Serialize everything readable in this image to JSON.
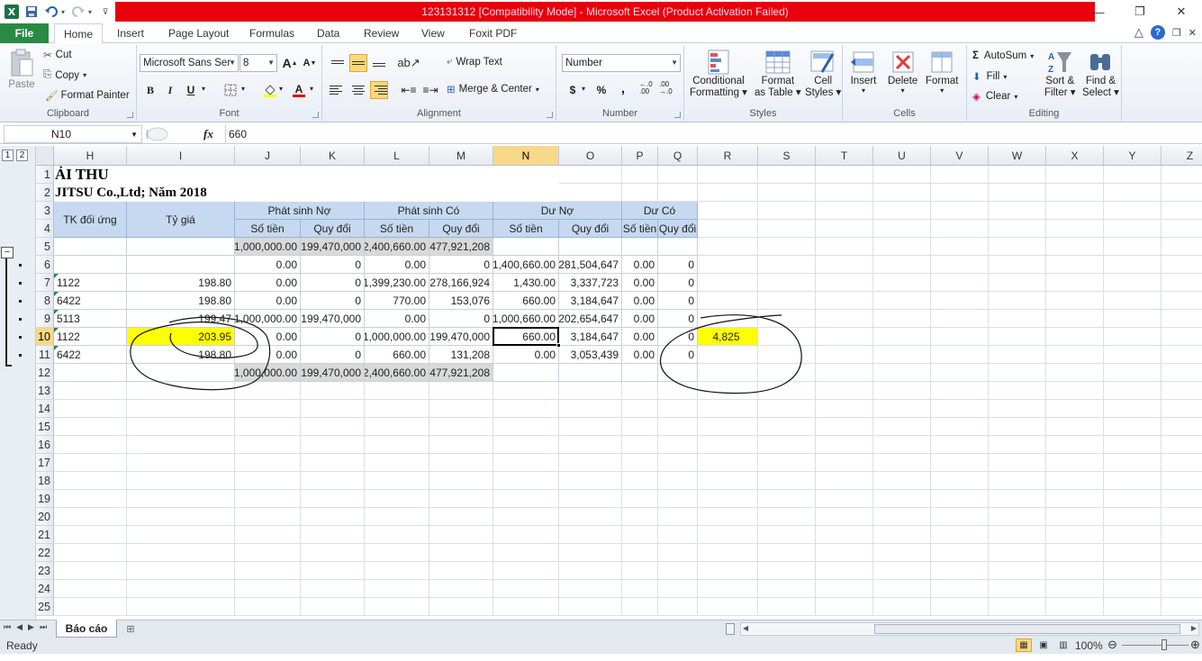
{
  "window": {
    "title": "123131312  [Compatibility Mode]  -  Microsoft Excel (Product Activation Failed)",
    "title_bar_color": "#e8000c",
    "controls": {
      "minimize": "—",
      "restore": "❐",
      "close": "✕"
    }
  },
  "ribbon_tabs": {
    "file": "File",
    "tabs": [
      "Home",
      "Insert",
      "Page Layout",
      "Formulas",
      "Data",
      "Review",
      "View",
      "Foxit PDF"
    ],
    "active": "Home"
  },
  "ribbon": {
    "clipboard": {
      "paste": "Paste",
      "cut": "Cut",
      "copy": "Copy",
      "format_painter": "Format Painter",
      "label": "Clipboard"
    },
    "font": {
      "name": "Microsoft Sans Ser",
      "size": "8",
      "bold": "B",
      "italic": "I",
      "underline": "U",
      "label": "Font"
    },
    "alignment": {
      "wrap_text": "Wrap Text",
      "merge_center": "Merge & Center",
      "label": "Alignment"
    },
    "number": {
      "format": "Number",
      "currency": "$",
      "percent": "%",
      "comma": ",",
      "inc_decimal": "←.0\n.00",
      "dec_decimal": ".00\n→.0",
      "label": "Number"
    },
    "styles": {
      "conditional": [
        "Conditional",
        "Formatting"
      ],
      "format_table": [
        "Format",
        "as Table"
      ],
      "cell_styles": [
        "Cell",
        "Styles"
      ],
      "label": "Styles"
    },
    "cells": {
      "insert": "Insert",
      "delete": "Delete",
      "format": "Format",
      "label": "Cells"
    },
    "editing": {
      "autosum": "AutoSum",
      "fill": "Fill",
      "clear": "Clear",
      "sort": [
        "Sort &",
        "Filter"
      ],
      "find": [
        "Find &",
        "Select"
      ],
      "label": "Editing"
    }
  },
  "formula_bar": {
    "name_box": "N10",
    "fx": "fx",
    "value": "660"
  },
  "outline": {
    "levels": [
      "1",
      "2"
    ],
    "collapse": "−"
  },
  "columns": [
    "H",
    "I",
    "J",
    "K",
    "L",
    "M",
    "N",
    "O",
    "P",
    "Q",
    "R",
    "S",
    "T",
    "U",
    "V",
    "W",
    "X",
    "Y",
    "Z"
  ],
  "rows": [
    "1",
    "2",
    "3",
    "4",
    "5",
    "6",
    "7",
    "8",
    "9",
    "10",
    "11",
    "12",
    "13",
    "14",
    "15",
    "16",
    "17",
    "18",
    "19",
    "20",
    "21",
    "22",
    "23",
    "24",
    "25"
  ],
  "sheet": {
    "title": "ẢI THU",
    "subtitle": "JITSU Co.,Ltd; Năm 2018",
    "headers": {
      "tk_doi_ung": "TK đối ứng",
      "ty_gia": "Tỷ giá",
      "phat_sinh_no": "Phát sinh Nợ",
      "phat_sinh_co": "Phát sinh Có",
      "du_no": "Dư Nợ",
      "du_co": "Dư Có",
      "so_tien": "Số tiền",
      "quy_doi": "Quy đổi"
    },
    "data_rows": [
      {
        "row": "5",
        "H": "",
        "I": "",
        "J": "1,000,000.00",
        "K": "199,470,000",
        "L": "2,400,660.00",
        "M": "477,921,208",
        "N": "",
        "O": "",
        "P": "",
        "Q": ""
      },
      {
        "row": "6",
        "H": "",
        "I": "",
        "J": "0.00",
        "K": "0",
        "L": "0.00",
        "M": "0",
        "N": "1,400,660.00",
        "O": "281,504,647",
        "P": "0.00",
        "Q": "0"
      },
      {
        "row": "7",
        "H": "1122",
        "I": "198.80",
        "J": "0.00",
        "K": "0",
        "L": "1,399,230.00",
        "M": "278,166,924",
        "N": "1,430.00",
        "O": "3,337,723",
        "P": "0.00",
        "Q": "0"
      },
      {
        "row": "8",
        "H": "6422",
        "I": "198.80",
        "J": "0.00",
        "K": "0",
        "L": "770.00",
        "M": "153,076",
        "N": "660.00",
        "O": "3,184,647",
        "P": "0.00",
        "Q": "0"
      },
      {
        "row": "9",
        "H": "5113",
        "I": "199.47",
        "J": "1,000,000.00",
        "K": "199,470,000",
        "L": "0.00",
        "M": "0",
        "N": "1,000,660.00",
        "O": "202,654,647",
        "P": "0.00",
        "Q": "0"
      },
      {
        "row": "10",
        "H": "1122",
        "I": "203.95",
        "J": "0.00",
        "K": "0",
        "L": "1,000,000.00",
        "M": "199,470,000",
        "N": "660.00",
        "O": "3,184,647",
        "P": "0.00",
        "Q": "0",
        "R": "4,825"
      },
      {
        "row": "11",
        "H": "6422",
        "I": "198.80",
        "J": "0.00",
        "K": "0",
        "L": "660.00",
        "M": "131,208",
        "N": "0.00",
        "O": "3,053,439",
        "P": "0.00",
        "Q": "0"
      },
      {
        "row": "12",
        "H": "",
        "I": "",
        "J": "1,000,000.00",
        "K": "199,470,000",
        "L": "2,400,660.00",
        "M": "477,921,208",
        "N": "",
        "O": "",
        "P": "",
        "Q": ""
      }
    ],
    "header_fill": "#c6d9f0",
    "total_fill": "#d9d9d9",
    "highlight_fill": "#ffff00"
  },
  "sheet_tabs": {
    "active": "Báo cáo"
  },
  "status": {
    "mode": "Ready",
    "zoom": "100%"
  }
}
